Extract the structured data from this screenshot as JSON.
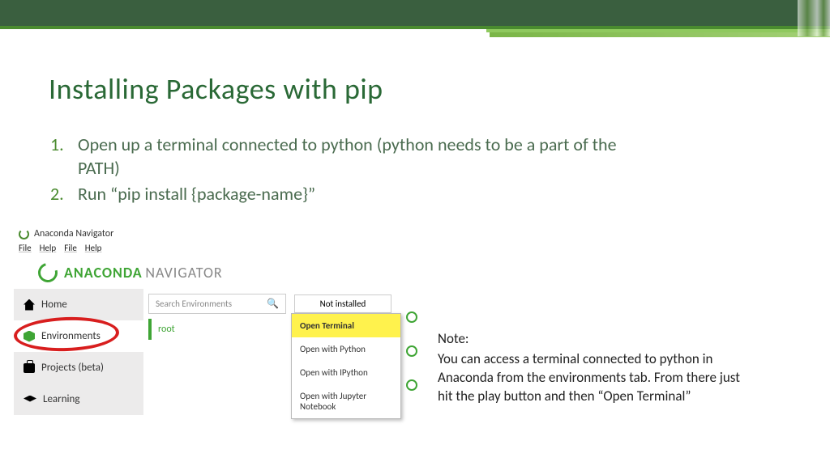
{
  "slide": {
    "title": "Installing Packages with pip",
    "steps": [
      {
        "num": "1.",
        "text": "Open up a terminal connected to python (python needs to be a part of the PATH)"
      },
      {
        "num": "2.",
        "text": "Run “pip install {package-name}”"
      }
    ]
  },
  "navigator": {
    "window_title": "Anaconda Navigator",
    "menu": [
      "File",
      "Help",
      "File",
      "Help"
    ],
    "logo_bold": "ANACONDA",
    "logo_light": "NAVIGATOR",
    "sidebar": [
      {
        "label": "Home"
      },
      {
        "label": "Environments"
      },
      {
        "label": "Projects (beta)"
      },
      {
        "label": "Learning"
      }
    ],
    "search_placeholder": "Search Environments",
    "filter_label": "Not installed",
    "env_name": "root",
    "dropdown": [
      "Open Terminal",
      "Open with Python",
      "Open with IPython",
      "Open with Jupyter Notebook"
    ]
  },
  "note": {
    "title": "Note:",
    "body": "You can access a terminal connected to python in Anaconda from the environments tab. From there just hit the play button and then “Open Terminal”"
  }
}
